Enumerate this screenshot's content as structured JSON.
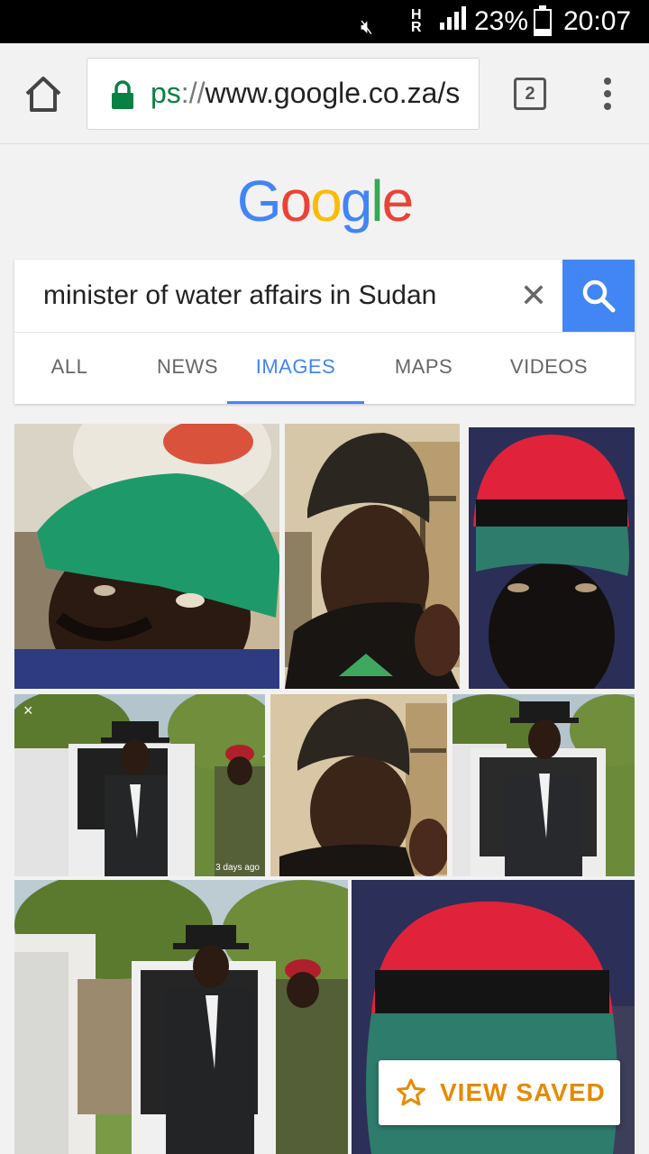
{
  "status_bar": {
    "network": "H\nR",
    "battery": "23%",
    "time": "20:07",
    "icons": [
      "mute-icon",
      "signal-icon",
      "battery-icon"
    ]
  },
  "browser": {
    "url_scheme": "ps",
    "url_slashes": "://",
    "url_rest": "www.google.co.za/s",
    "tab_count": "2"
  },
  "google": {
    "logo_letters": [
      {
        "ch": "G",
        "color": "#4285f4"
      },
      {
        "ch": "o",
        "color": "#ea4335"
      },
      {
        "ch": "o",
        "color": "#fbbc05"
      },
      {
        "ch": "g",
        "color": "#4285f4"
      },
      {
        "ch": "l",
        "color": "#34a853"
      },
      {
        "ch": "e",
        "color": "#ea4335"
      }
    ]
  },
  "search": {
    "query": "minister of water affairs in Sudan",
    "clear_symbol": "✕"
  },
  "tabs": [
    {
      "label": "ALL",
      "active": false
    },
    {
      "label": "NEWS",
      "active": false
    },
    {
      "label": "IMAGES",
      "active": true
    },
    {
      "label": "MAPS",
      "active": false
    },
    {
      "label": "VIDEOS",
      "active": false
    }
  ],
  "results": {
    "row2_left_close": "×",
    "row2_left_date": "3 days ago"
  },
  "view_saved": {
    "label": "VIEW SAVED"
  },
  "colors": {
    "accent": "#4285f4",
    "saved": "#e68a00"
  }
}
